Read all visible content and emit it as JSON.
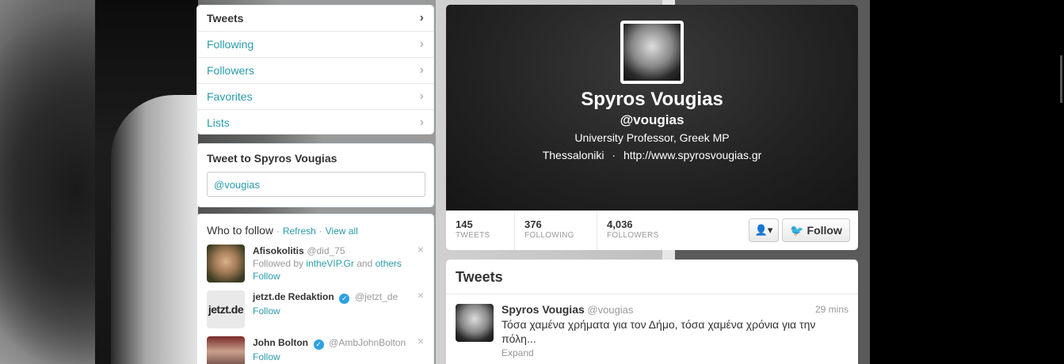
{
  "nav": {
    "items": [
      {
        "label": "Tweets",
        "active": true
      },
      {
        "label": "Following",
        "active": false
      },
      {
        "label": "Followers",
        "active": false
      },
      {
        "label": "Favorites",
        "active": false
      },
      {
        "label": "Lists",
        "active": false
      }
    ]
  },
  "tweet_to": {
    "title": "Tweet to Spyros Vougias",
    "input_value": "@vougias"
  },
  "who_to_follow": {
    "title": "Who to follow",
    "sep": "·",
    "refresh": "Refresh",
    "view_all": "View all",
    "users": [
      {
        "name": "Afisokolitis",
        "handle": "@did_75",
        "followed_by_prefix": "Followed by",
        "followed_by_user": "intheVIP.Gr",
        "followed_by_and": "and",
        "followed_by_others": "others",
        "follow": "Follow",
        "close": "×"
      },
      {
        "name": "jetzt.de Redaktion",
        "handle": "@jetzt_de",
        "avatar_text": "jetzt.de",
        "follow": "Follow",
        "close": "×"
      },
      {
        "name": "John Bolton",
        "handle": "@AmbJohnBolton",
        "follow": "Follow",
        "close": "×"
      }
    ]
  },
  "profile": {
    "name": "Spyros Vougias",
    "handle": "@vougias",
    "bio": "University Professor, Greek MP",
    "location": "Thessaloniki",
    "loc_sep": "·",
    "url": "http://www.spyrosvougias.gr",
    "stats": [
      {
        "value": "145",
        "label": "TWEETS"
      },
      {
        "value": "376",
        "label": "FOLLOWING"
      },
      {
        "value": "4,036",
        "label": "FOLLOWERS"
      }
    ],
    "follow_button": "Follow",
    "user_menu_icon": "person-dropdown-icon"
  },
  "timeline": {
    "title": "Tweets",
    "tweets": [
      {
        "name": "Spyros Vougias",
        "handle": "@vougias",
        "time": "29 mins",
        "text": "Τόσα χαμένα χρήματα για τον Δήμο, τόσα χαμένα χρόνια για την πόλη...",
        "expand": "Expand"
      }
    ]
  },
  "colors": {
    "link": "#2a9bab",
    "verified": "#2fa1e0",
    "header_bg": "#222222"
  }
}
